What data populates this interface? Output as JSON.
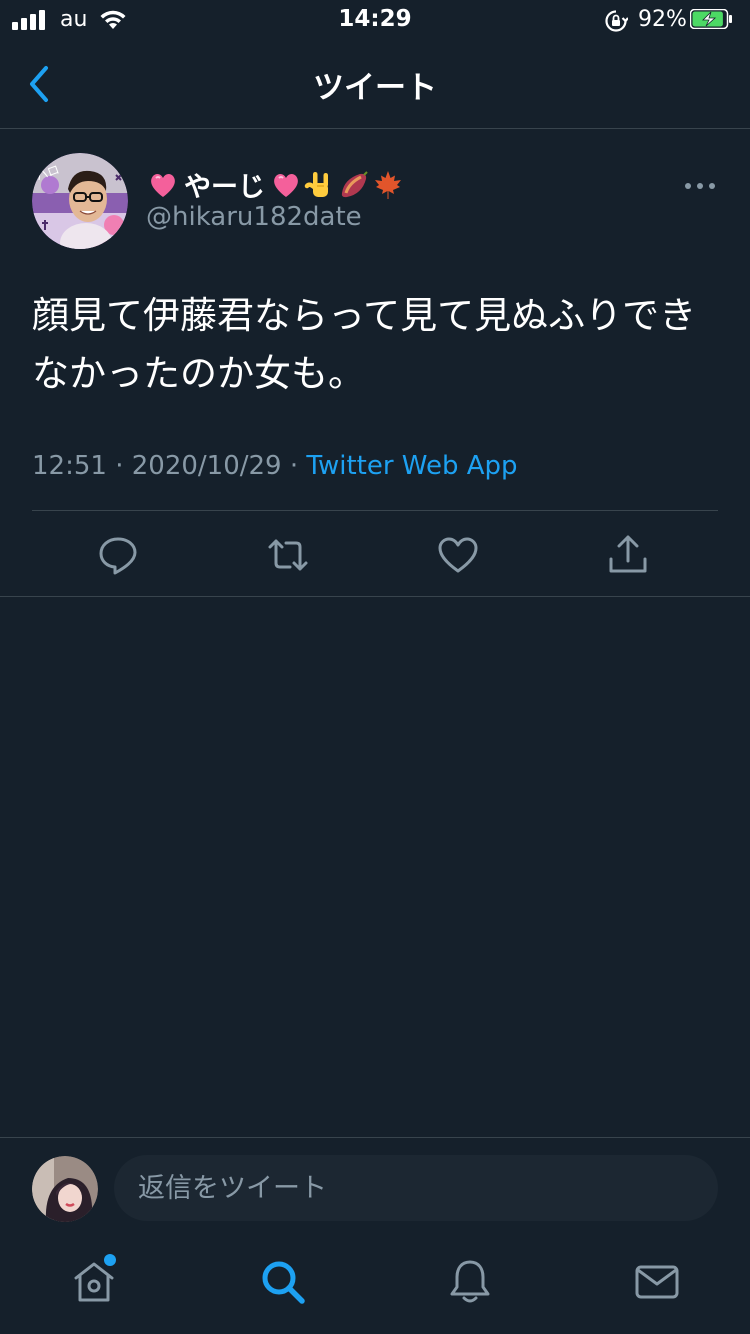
{
  "status_bar": {
    "carrier": "au",
    "time": "14:29",
    "battery_percent": "92%",
    "battery_level": 0.92,
    "charging": true
  },
  "header": {
    "title": "ツイート",
    "back_icon": "chevron-left-icon"
  },
  "tweet": {
    "display_name": "やーじ",
    "name_emojis": [
      "pink-heart-emoji",
      "pink-heart-emoji",
      "rock-on-hand-emoji",
      "sweet-potato-emoji",
      "maple-leaf-emoji"
    ],
    "handle": "@hikaru182date",
    "text": "顔見て伊藤君ならって見て見ぬふりできなかったのか女も。",
    "time": "12:51",
    "separator": " · ",
    "date": "2020/10/29",
    "source": "Twitter Web App",
    "actions": [
      "reply-icon",
      "retweet-icon",
      "like-icon",
      "share-icon"
    ]
  },
  "reply": {
    "placeholder": "返信をツイート"
  },
  "tab_bar": {
    "tabs": [
      "home-icon",
      "search-icon",
      "notifications-icon",
      "messages-icon"
    ],
    "active": "search-icon",
    "home_has_dot": true
  },
  "colors": {
    "background": "#15202b",
    "divider": "#38444d",
    "accent": "#1da1f2",
    "secondary_text": "#8899a6",
    "input_bg": "#1c2732"
  }
}
